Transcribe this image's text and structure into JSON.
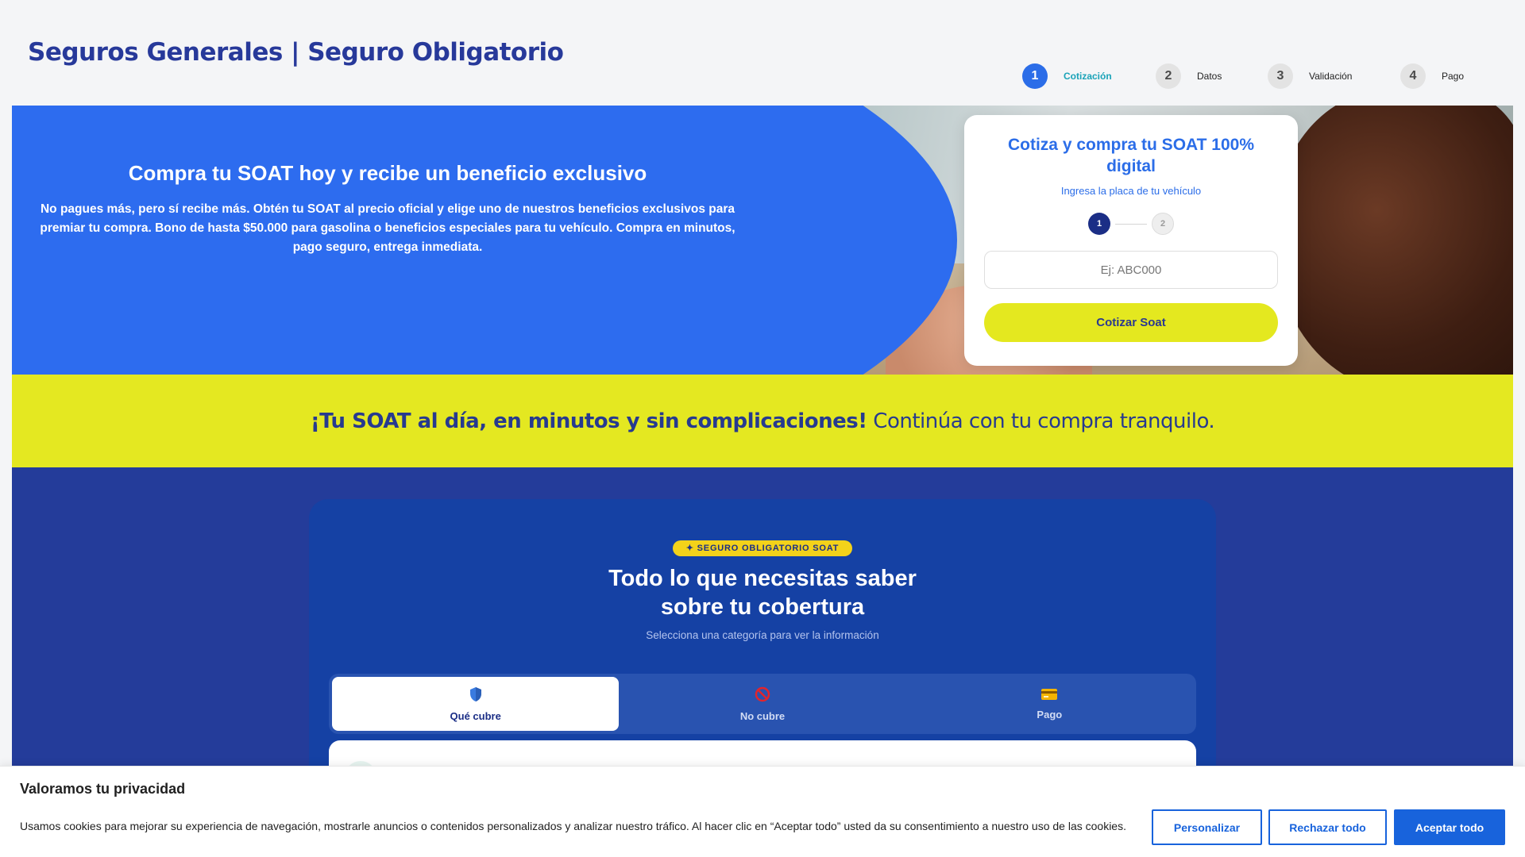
{
  "header": {
    "title": "Seguros Generales | Seguro Obligatorio",
    "steps": [
      {
        "number": "1",
        "label": "Cotización"
      },
      {
        "number": "2",
        "label": "Datos"
      },
      {
        "number": "3",
        "label": "Validación"
      },
      {
        "number": "4",
        "label": "Pago"
      }
    ],
    "active_step": 1
  },
  "hero": {
    "title": "Compra tu SOAT hoy y recibe un beneficio exclusivo",
    "description": "No pagues más, pero sí recibe más. Obtén tu SOAT al precio oficial y elige uno de nuestros beneficios exclusivos para premiar tu compra. Bono de hasta $50.000 para gasolina o beneficios especiales para tu vehículo. Compra en minutos, pago seguro, entrega inmediata."
  },
  "quote_card": {
    "title": "Cotiza y compra tu SOAT 100% digital",
    "subtitle": "Ingresa la placa de tu vehículo",
    "steps": [
      "1",
      "2"
    ],
    "plate_placeholder": "Ej: ABC000",
    "plate_value": "",
    "button_label": "Cotizar Soat"
  },
  "promo": {
    "bold_text": "¡Tu SOAT al día, en minutos y sin complicaciones!",
    "regular_text": " Continúa con tu compra tranquilo."
  },
  "coverage": {
    "badge": "✦ SEGURO OBLIGATORIO SOAT",
    "title_line1": "Todo lo que necesitas saber",
    "title_line2": "sobre tu cobertura",
    "subtitle": "Selecciona una categoría para ver la información",
    "tabs": [
      {
        "label": "Qué cubre",
        "icon": "shield-icon"
      },
      {
        "label": "No cubre",
        "icon": "prohibited-icon"
      },
      {
        "label": "Pago",
        "icon": "credit-card-icon"
      }
    ],
    "active_tab": 0
  },
  "cookies": {
    "title": "Valoramos tu privacidad",
    "text": "Usamos cookies para mejorar su experiencia de navegación, mostrarle anuncios o contenidos personalizados y analizar nuestro tráfico. Al hacer clic en “Aceptar todo” usted da su consentimiento a nuestro uso de las cookies.",
    "customize_label": "Personalizar",
    "reject_label": "Rechazar todo",
    "accept_label": "Aceptar todo"
  },
  "colors": {
    "brand_blue": "#2d6cef",
    "brand_navy": "#243c9a",
    "accent_yellow": "#e4e821",
    "step_active": "#2b6de8",
    "cookie_blue": "#1863dc"
  }
}
